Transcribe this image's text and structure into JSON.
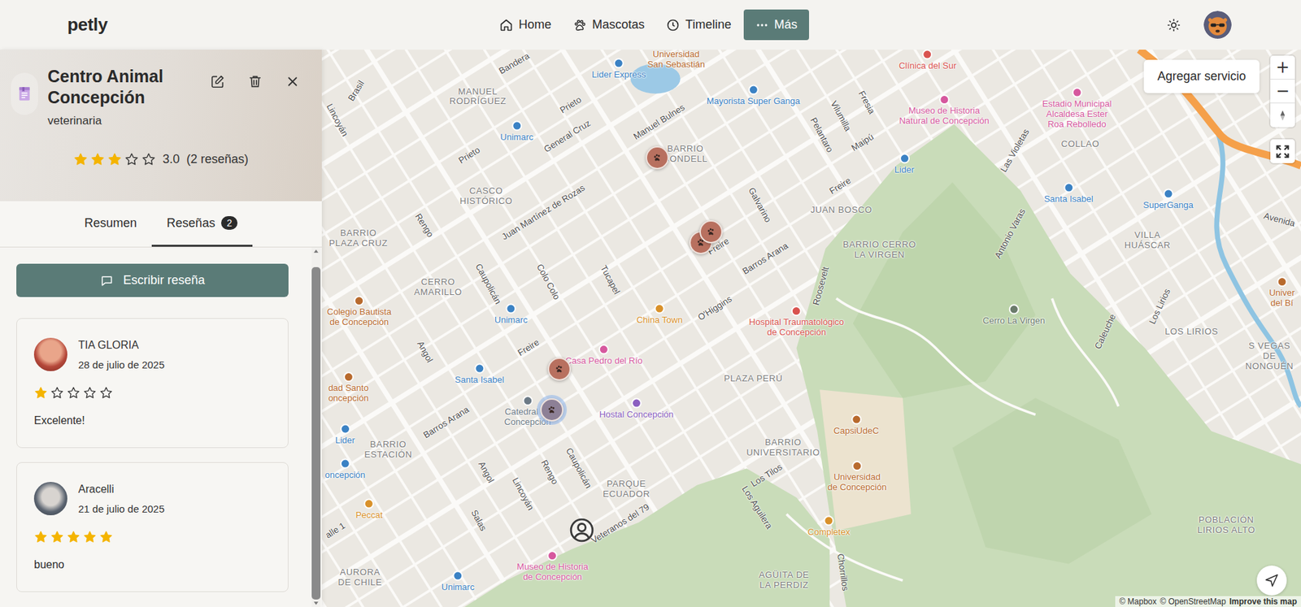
{
  "app": {
    "logo": "petly"
  },
  "nav": [
    {
      "label": "Home",
      "selected": false
    },
    {
      "label": "Mascotas",
      "selected": false
    },
    {
      "label": "Timeline",
      "selected": false
    },
    {
      "label": "Más",
      "selected": true
    }
  ],
  "place": {
    "title": "Centro Animal Concepción",
    "category": "veterinaria",
    "stars": 3,
    "rating": "3.0",
    "reviews_count": "(2 reseñas)"
  },
  "tabs": [
    {
      "label": "Resumen",
      "selected": false
    },
    {
      "label": "Reseñas",
      "badge": "2",
      "selected": true
    }
  ],
  "write_review_button": "Escribir reseña",
  "reviews": [
    {
      "author": "TIA GLORIA",
      "date": "28 de julio de 2025",
      "stars": 1,
      "text": "Excelente!"
    },
    {
      "author": "Aracelli",
      "date": "21 de julio de 2025",
      "stars": 5,
      "text": "bueno"
    }
  ],
  "map": {
    "add_service_button": "Agregar servicio",
    "zoom_in": "+",
    "zoom_out": "−",
    "attribution": [
      "© Mapbox",
      "© OpenStreetMap",
      "Improve this map"
    ],
    "pins": [
      {
        "selected": false
      },
      {
        "selected": false
      },
      {
        "selected": false
      },
      {
        "selected": false
      },
      {
        "selected": true
      }
    ],
    "labels": [
      {
        "text": "Brasil",
        "kind": "street"
      },
      {
        "text": "Bandera",
        "kind": "street"
      },
      {
        "text": "Prieto",
        "kind": "street"
      },
      {
        "text": "General Cruz",
        "kind": "street"
      },
      {
        "text": "Manuel Bulnes",
        "kind": "street"
      },
      {
        "text": "Prieto",
        "kind": "street"
      },
      {
        "text": "Juan Martínez de Rozas",
        "kind": "street"
      },
      {
        "text": "Rengo",
        "kind": "street"
      },
      {
        "text": "Caupolicán",
        "kind": "street"
      },
      {
        "text": "Colo Colo",
        "kind": "street"
      },
      {
        "text": "Tucapel",
        "kind": "street"
      },
      {
        "text": "Angol",
        "kind": "street"
      },
      {
        "text": "Freire",
        "kind": "street"
      },
      {
        "text": "Barros Arana",
        "kind": "street"
      },
      {
        "text": "Angol",
        "kind": "street"
      },
      {
        "text": "Lincoyán",
        "kind": "street"
      },
      {
        "text": "Rengo",
        "kind": "street"
      },
      {
        "text": "Caupolicán",
        "kind": "street"
      },
      {
        "text": "Salas",
        "kind": "street"
      },
      {
        "text": "Veteranos del 79",
        "kind": "street"
      },
      {
        "text": "Freire",
        "kind": "street"
      },
      {
        "text": "Barros Arana",
        "kind": "street"
      },
      {
        "text": "O'Higgins",
        "kind": "street"
      },
      {
        "text": "Galvarino",
        "kind": "street"
      },
      {
        "text": "Freire",
        "kind": "street"
      },
      {
        "text": "Maipú",
        "kind": "street"
      },
      {
        "text": "Pelantaro",
        "kind": "street"
      },
      {
        "text": "Vilumilla",
        "kind": "street"
      },
      {
        "text": "Fresia",
        "kind": "street"
      },
      {
        "text": "Roosevelt",
        "kind": "street"
      },
      {
        "text": "Los Tilos",
        "kind": "street"
      },
      {
        "text": "Los Aguilera",
        "kind": "street"
      },
      {
        "text": "Chorrillos",
        "kind": "street"
      },
      {
        "text": "Antonio Varas",
        "kind": "street"
      },
      {
        "text": "Las Violetas",
        "kind": "street"
      },
      {
        "text": "Caleuche",
        "kind": "street"
      },
      {
        "text": "Los Lirios",
        "kind": "street"
      },
      {
        "text": "Lincoyán",
        "kind": "street"
      },
      {
        "text": "alle 1",
        "kind": "street"
      },
      {
        "text": "Avenida",
        "kind": "street"
      },
      {
        "text": "MANUEL\nRODRÍGUEZ",
        "kind": "area"
      },
      {
        "text": "CASCO\nHISTÓRICO",
        "kind": "area"
      },
      {
        "text": "BARRIO\nPLAZA CRUZ",
        "kind": "area"
      },
      {
        "text": "CERRO\nAMARILLO",
        "kind": "area"
      },
      {
        "text": "BARRIO\nCONDELL",
        "kind": "area"
      },
      {
        "text": "JUAN BOSCO",
        "kind": "area"
      },
      {
        "text": "BARRIO CERRO\nLA VIRGEN",
        "kind": "area"
      },
      {
        "text": "PLAZA PERÚ",
        "kind": "area"
      },
      {
        "text": "BARRIO\nUNIVERSITARIO",
        "kind": "area"
      },
      {
        "text": "PARQUE\nECUADOR",
        "kind": "area"
      },
      {
        "text": "BARRIO\nESTACIÓN",
        "kind": "area"
      },
      {
        "text": "AURORA\nDE CHILE",
        "kind": "area"
      },
      {
        "text": "AGÜITA DE\nLA PERDIZ",
        "kind": "area"
      },
      {
        "text": "COLLAO",
        "kind": "area"
      },
      {
        "text": "VILLA\nHUÁSCAR",
        "kind": "area"
      },
      {
        "text": "LOS LIRIOS",
        "kind": "area"
      },
      {
        "text": "POBLACIÓN\nLIRIOS ALTO",
        "kind": "area"
      },
      {
        "text": "S VEGAS\nDE NONGUÉN",
        "kind": "area"
      },
      {
        "text": "Universidad\nSan Sebastián",
        "kind": "poi",
        "color": "#b86a2d"
      },
      {
        "text": "Lider Express",
        "kind": "poi",
        "color": "#3b82c4"
      },
      {
        "text": "Mayorista Super Ganga",
        "kind": "poi",
        "color": "#3b82c4"
      },
      {
        "text": "Clínica del Sur",
        "kind": "poi",
        "color": "#d9534f"
      },
      {
        "text": "Museo de Historia\nNatural de Concepción",
        "kind": "poi",
        "color": "#d6589e"
      },
      {
        "text": "Estadio Municipal\nAlcaldesa Ester\nRoa Rebolledo",
        "kind": "poi",
        "color": "#d6589e"
      },
      {
        "text": "Unimarc",
        "kind": "poi",
        "color": "#3b82c4"
      },
      {
        "text": "Lider",
        "kind": "poi",
        "color": "#3b82c4"
      },
      {
        "text": "Santa Isabel",
        "kind": "poi",
        "color": "#3b82c4"
      },
      {
        "text": "SuperGanga",
        "kind": "poi",
        "color": "#3b82c4"
      },
      {
        "text": "Unimarc",
        "kind": "poi",
        "color": "#3b82c4"
      },
      {
        "text": "China Town",
        "kind": "poi",
        "color": "#d9912a"
      },
      {
        "text": "Hospital Traumatológico\nde Concepción",
        "kind": "poi",
        "color": "#d9534f"
      },
      {
        "text": "Colegio Bautista\nde Concepción",
        "kind": "poi",
        "color": "#b86a2d"
      },
      {
        "text": "Cerro La Virgen",
        "kind": "poi",
        "color": "#6b7b6b"
      },
      {
        "text": "Casa Pedro del Río",
        "kind": "poi",
        "color": "#d6589e"
      },
      {
        "text": "Santa Isabel",
        "kind": "poi",
        "color": "#3b82c4"
      },
      {
        "text": "Hostal Concepción",
        "kind": "poi",
        "color": "#8b5fc0"
      },
      {
        "text": "Catedral de\nConcepción",
        "kind": "poi",
        "color": "#6c7a86"
      },
      {
        "text": "dad Santo\noncepción",
        "kind": "poi",
        "color": "#b86a2d"
      },
      {
        "text": "Lider",
        "kind": "poi",
        "color": "#3b82c4"
      },
      {
        "text": "oncepción",
        "kind": "poi",
        "color": "#3b82c4"
      },
      {
        "text": "Peccat",
        "kind": "poi",
        "color": "#d9912a"
      },
      {
        "text": "Museo de Historia\nde Concepción",
        "kind": "poi",
        "color": "#d6589e"
      },
      {
        "text": "Unimarc",
        "kind": "poi",
        "color": "#3b82c4"
      },
      {
        "text": "CapsiUdeC",
        "kind": "poi",
        "color": "#b86a2d"
      },
      {
        "text": "Universidad\nde Concepción",
        "kind": "poi",
        "color": "#b86a2d"
      },
      {
        "text": "Completex",
        "kind": "poi",
        "color": "#d9912a"
      },
      {
        "text": "Univer\ndel Bí",
        "kind": "poi",
        "color": "#b86a2d"
      }
    ]
  }
}
